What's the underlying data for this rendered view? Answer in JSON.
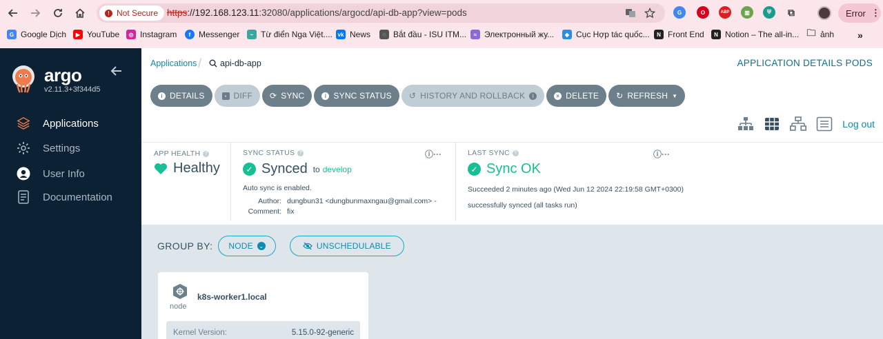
{
  "browser": {
    "not_secure_label": "Not Secure",
    "url_scheme": "https",
    "url_host": "://192.168.123.11",
    "url_rest": ":32080/applications/argocd/api-db-app?view=pods",
    "profile_status": "Error",
    "bookmarks": [
      {
        "label": "Google Dịch",
        "icon": "google-translate-icon",
        "color": "#4285f4"
      },
      {
        "label": "YouTube",
        "icon": "youtube-icon",
        "color": "#ff0000"
      },
      {
        "label": "Instagram",
        "icon": "instagram-icon",
        "color": "#d6249f"
      },
      {
        "label": "Messenger",
        "icon": "facebook-icon",
        "color": "#1877f2"
      },
      {
        "label": "Từ điển Nga Việt....",
        "icon": "dictionary-icon",
        "color": "#3aa6a0"
      },
      {
        "label": "News",
        "icon": "vk-icon",
        "color": "#0077ff"
      },
      {
        "label": "Bắt đầu - ISU ITM...",
        "icon": "isu-icon",
        "color": "#555555"
      },
      {
        "label": "Электронный жу...",
        "icon": "journal-icon",
        "color": "#8a6bd1"
      },
      {
        "label": "Cục Hợp tác quốc...",
        "icon": "ministry-icon",
        "color": "#2a8de0"
      },
      {
        "label": "Front End",
        "icon": "notion-icon",
        "color": "#222222"
      },
      {
        "label": "Notion – The all-in...",
        "icon": "notion-icon",
        "color": "#222222"
      },
      {
        "label": "ảnh",
        "icon": "folder-icon",
        "color": "#444444"
      }
    ]
  },
  "sidebar": {
    "brand": "argo",
    "version": "v2.11.3+3f344d5",
    "items": [
      {
        "label": "Applications",
        "icon": "layers-icon",
        "active": true
      },
      {
        "label": "Settings",
        "icon": "gear-icon",
        "active": false
      },
      {
        "label": "User Info",
        "icon": "user-icon",
        "active": false
      },
      {
        "label": "Documentation",
        "icon": "document-icon",
        "active": false
      }
    ]
  },
  "header": {
    "breadcrumb_root": "Applications",
    "breadcrumb_app": "api-db-app",
    "title": "APPLICATION DETAILS PODS"
  },
  "toolbar": {
    "details": "DETAILS",
    "diff": "DIFF",
    "sync": "SYNC",
    "sync_status": "SYNC STATUS",
    "history": "HISTORY AND ROLLBACK",
    "delete": "DELETE",
    "refresh": "REFRESH"
  },
  "view_switch": {
    "logout": "Log out"
  },
  "status": {
    "health_label": "APP HEALTH",
    "health_value": "Healthy",
    "sync_label": "SYNC STATUS",
    "sync_value": "Synced",
    "sync_to": "to",
    "sync_branch": "develop",
    "auto_sync": "Auto sync is enabled.",
    "author_label": "Author:",
    "author_value": "dungbun31 <dungbunmaxngau@gmail.com> -",
    "comment_label": "Comment:",
    "comment_value": "fix",
    "last_sync_label": "LAST SYNC",
    "last_sync_value": "Sync OK",
    "last_sync_time": "Succeeded 2 minutes ago (Wed Jun 12 2024 22:19:58 GMT+0300)",
    "last_sync_message": "successfully synced (all tasks run)"
  },
  "groupby": {
    "label": "GROUP BY:",
    "node_button": "NODE",
    "unschedulable_button": "UNSCHEDULABLE"
  },
  "node_card": {
    "type": "node",
    "name": "k8s-worker1.local",
    "kernel_label": "Kernel Version:",
    "kernel_value": "5.15.0-92-generic"
  },
  "colors": {
    "sidebar_bg": "#0c2133",
    "accent": "#0f8bab",
    "healthy_green": "#18be94",
    "button_gray": "#6d7f8b"
  }
}
